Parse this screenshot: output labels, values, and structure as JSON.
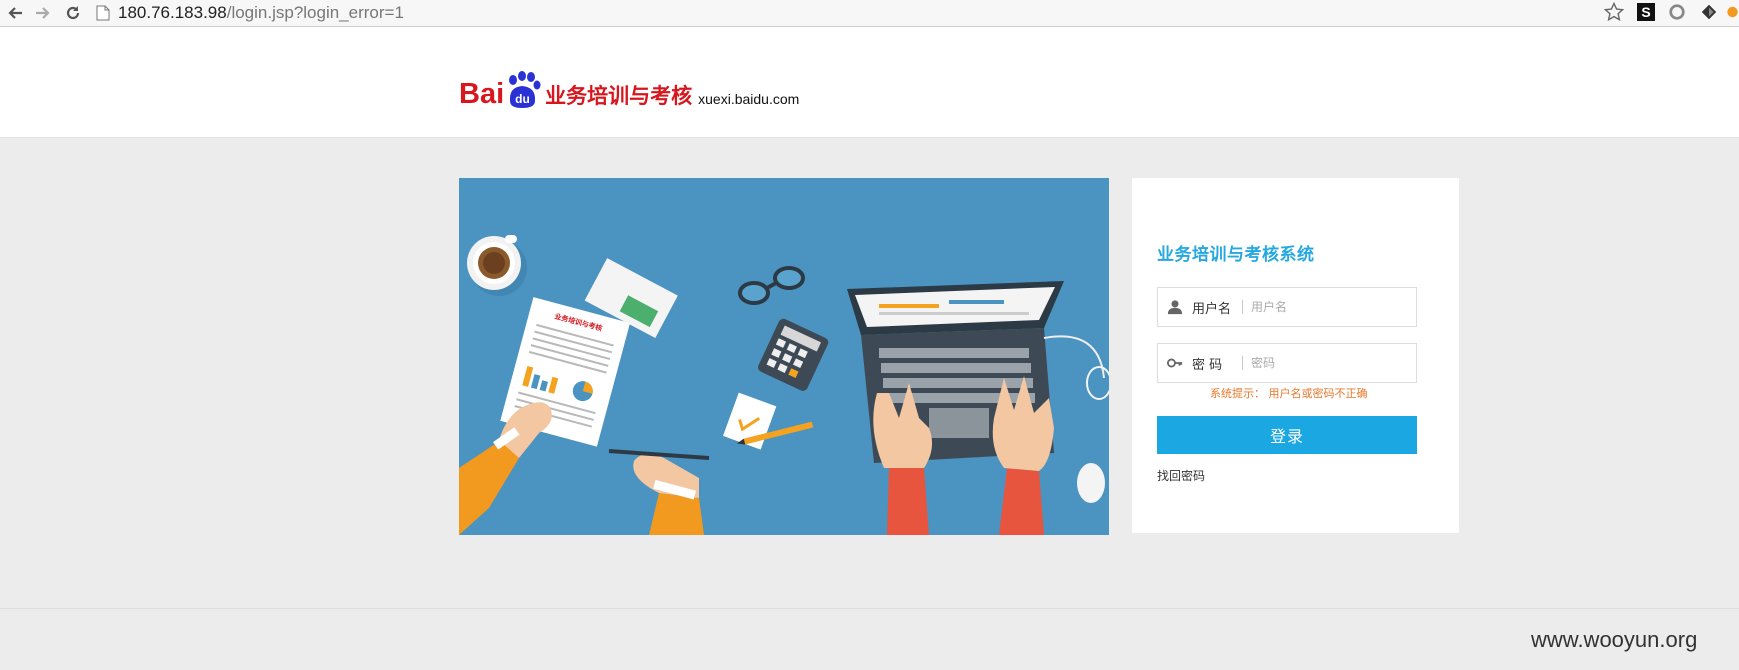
{
  "browser": {
    "url_host": "180.76.183.98",
    "url_path": "/login.jsp?login_error=1",
    "back_icon": "arrow-left-icon",
    "forward_icon": "arrow-right-icon",
    "reload_icon": "reload-icon",
    "bookmark_icon": "star-icon",
    "extensions": [
      {
        "name": "s-extension-icon",
        "label": "S"
      },
      {
        "name": "circle-extension-icon",
        "label": ""
      },
      {
        "name": "diamond-extension-icon",
        "label": ""
      }
    ]
  },
  "header": {
    "logo_bai": "Bai",
    "logo_du": "du",
    "logo_title": "业务培训与考核",
    "logo_domain": "xuexi.baidu.com"
  },
  "hero": {
    "doc_heading": "业务培训与考核"
  },
  "login": {
    "title": "业务培训与考核系统",
    "username_label": "用户名",
    "username_placeholder": "用户名",
    "password_label": "密 码",
    "password_placeholder": "密码",
    "error_tip": "系统提示： 用户名或密码不正确",
    "submit_label": "登录",
    "forgot_link": "找回密码"
  },
  "footer": {
    "watermark": "www.wooyun.org"
  },
  "colors": {
    "brand_red": "#d7161e",
    "accent_blue": "#1aa7e2",
    "hero_bg": "#4b93c0",
    "error_orange": "#e8782b"
  }
}
